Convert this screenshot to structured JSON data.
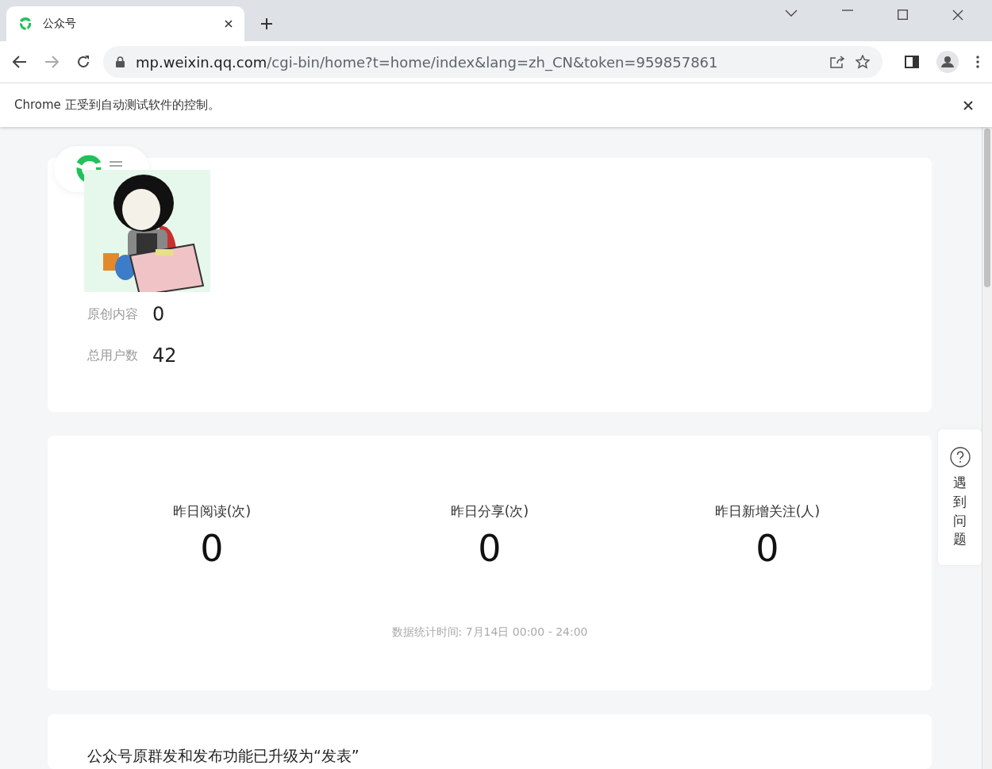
{
  "browser": {
    "tab": {
      "title": "公众号",
      "selected": true
    },
    "address": {
      "host": "mp.weixin.qq.com",
      "path": "/cgi-bin/home?t=home/index&lang=zh_CN&token=959857861"
    },
    "infobar": "Chrome 正受到自动测试软件的控制。"
  },
  "account": {
    "stats": [
      {
        "label": "原创内容",
        "value": "0"
      },
      {
        "label": "总用户数",
        "value": "42"
      }
    ]
  },
  "yesterday": {
    "metrics": [
      {
        "label": "昨日阅读(次)",
        "value": "0"
      },
      {
        "label": "昨日分享(次)",
        "value": "0"
      },
      {
        "label": "昨日新增关注(人)",
        "value": "0"
      }
    ],
    "note": "数据统计时间: 7月14日 00:00 - 24:00"
  },
  "notice": {
    "title": "公众号原群发和发布功能已升级为“发表”"
  },
  "help": {
    "label": "遇到问题"
  }
}
